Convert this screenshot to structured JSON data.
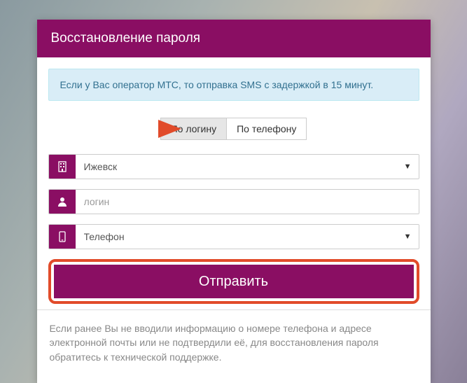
{
  "header": {
    "title": "Восстановление пароля"
  },
  "info": {
    "text": "Если у Вас оператор МТС, то отправка SMS с задержкой в 15 минут."
  },
  "tabs": {
    "by_login": "По логину",
    "by_phone": "По телефону"
  },
  "fields": {
    "city": {
      "value": "Ижевск"
    },
    "login": {
      "placeholder": "логин",
      "value": ""
    },
    "phone": {
      "value": "Телефон"
    }
  },
  "submit": {
    "label": "Отправить"
  },
  "footer": {
    "text": "Если ранее Вы не вводили информацию о номере телефона и адресе электронной почты или не подтвердили её, для восстановления пароля обратитесь к технической поддержке."
  },
  "colors": {
    "accent": "#8a0e63",
    "highlight": "#e14b2a"
  }
}
